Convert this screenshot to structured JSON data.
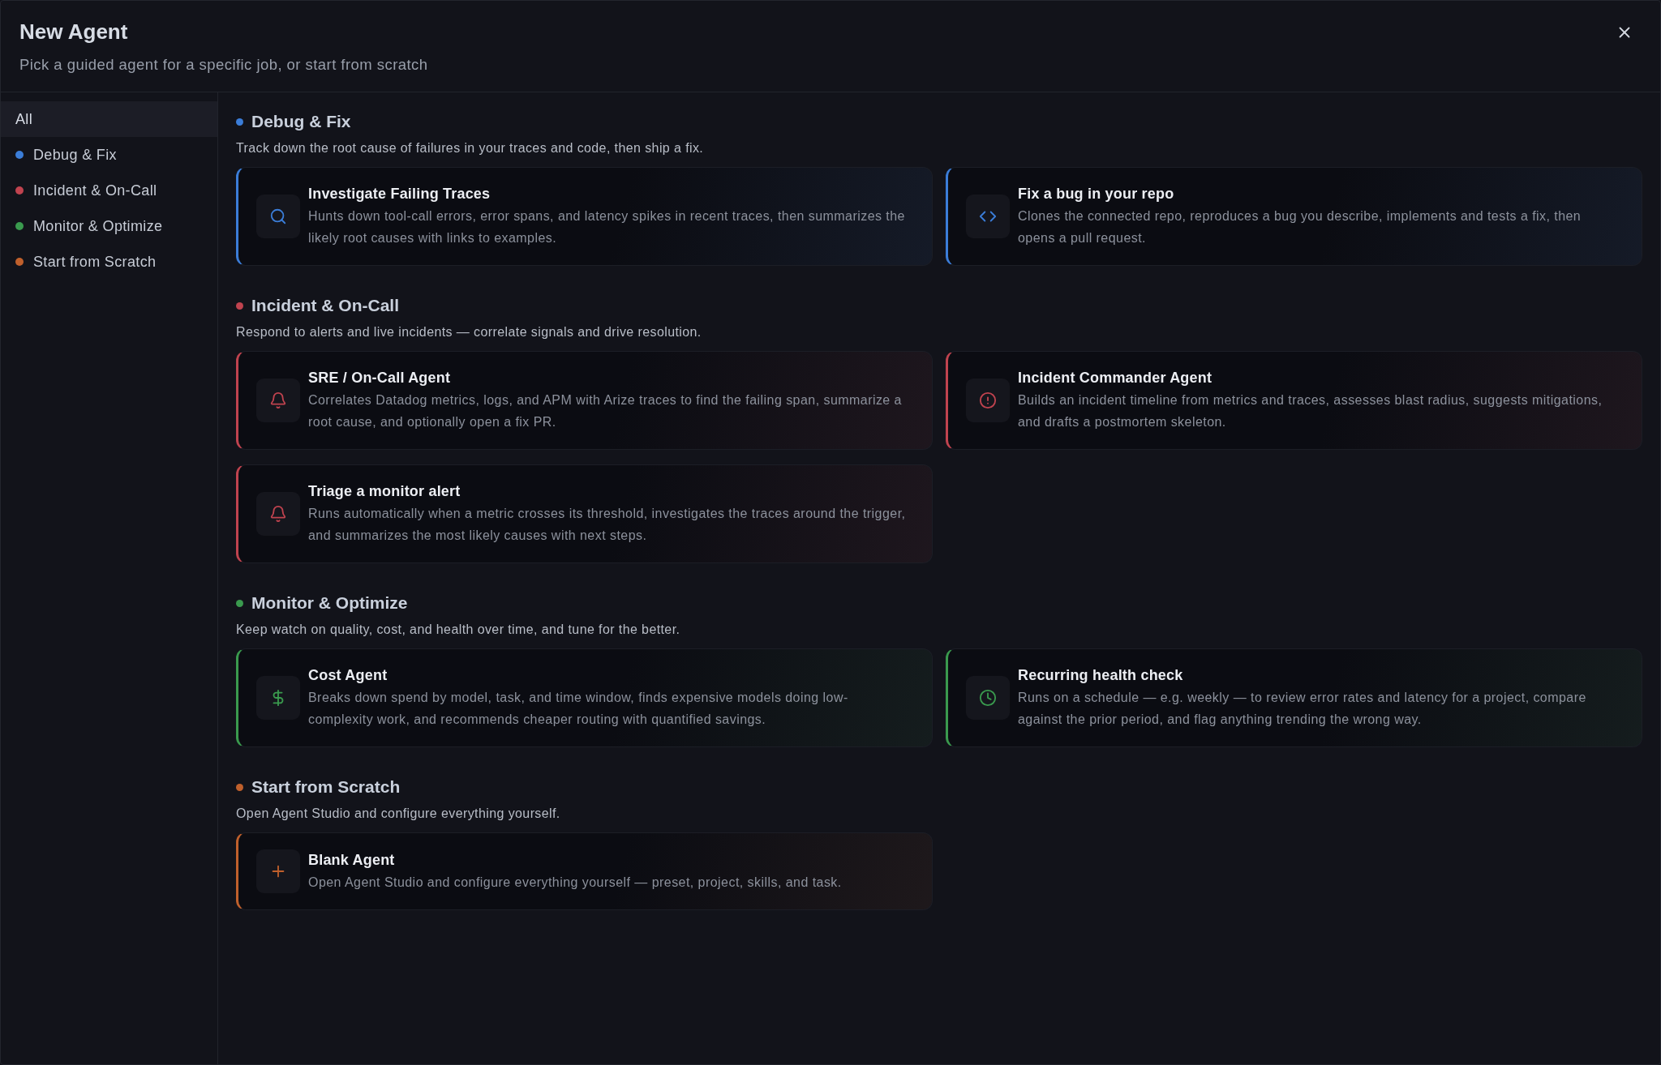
{
  "dialog": {
    "title": "New Agent",
    "subtitle": "Pick a guided agent for a specific job, or start from scratch"
  },
  "sidebar": {
    "items": [
      {
        "label": "All",
        "selected": true
      },
      {
        "label": "Debug & Fix",
        "selected": false,
        "color": "#3b7dd8"
      },
      {
        "label": "Incident & On-Call",
        "selected": false,
        "color": "#c0434f"
      },
      {
        "label": "Monitor & Optimize",
        "selected": false,
        "color": "#3a9a4e"
      },
      {
        "label": "Start from Scratch",
        "selected": false,
        "color": "#c0602c"
      }
    ]
  },
  "sections": [
    {
      "title": "Debug & Fix",
      "description": "Track down the root cause of failures in your traces and code, then ship a fix.",
      "color": "#3b7dd8",
      "cards": [
        {
          "kind": "search",
          "title": "Investigate Failing Traces",
          "description": "Hunts down tool-call errors, error spans, and latency spikes in recent traces, then summarizes the likely root causes with links to examples."
        },
        {
          "kind": "code",
          "title": "Fix a bug in your repo",
          "description": "Clones the connected repo, reproduces a bug you describe, implements and tests a fix, then opens a pull request."
        }
      ]
    },
    {
      "title": "Incident & On-Call",
      "description": "Respond to alerts and live incidents — correlate signals and drive resolution.",
      "color": "#c0434f",
      "cards": [
        {
          "kind": "bell",
          "title": "SRE / On-Call Agent",
          "description": "Correlates Datadog metrics, logs, and APM with Arize traces to find the failing span, summarize a root cause, and optionally open a fix PR."
        },
        {
          "kind": "alert",
          "title": "Incident Commander Agent",
          "description": "Builds an incident timeline from metrics and traces, assesses blast radius, suggests mitigations, and drafts a postmortem skeleton."
        },
        {
          "kind": "bell",
          "title": "Triage a monitor alert",
          "description": "Runs automatically when a metric crosses its threshold, investigates the traces around the trigger, and summarizes the most likely causes with next steps."
        }
      ]
    },
    {
      "title": "Monitor & Optimize",
      "description": "Keep watch on quality, cost, and health over time, and tune for the better.",
      "color": "#3a9a4e",
      "cards": [
        {
          "kind": "dollar",
          "title": "Cost Agent",
          "description": "Breaks down spend by model, task, and time window, finds expensive models doing low-complexity work, and recommends cheaper routing with quantified savings."
        },
        {
          "kind": "clock",
          "title": "Recurring health check",
          "description": "Runs on a schedule — e.g. weekly — to review error rates and latency for a project, compare against the prior period, and flag anything trending the wrong way."
        }
      ]
    },
    {
      "title": "Start from Scratch",
      "description": "Open Agent Studio and configure everything yourself.",
      "color": "#c0602c",
      "cards": [
        {
          "kind": "plus",
          "title": "Blank Agent",
          "description": "Open Agent Studio and configure everything yourself — preset, project, skills, and task."
        }
      ]
    }
  ]
}
